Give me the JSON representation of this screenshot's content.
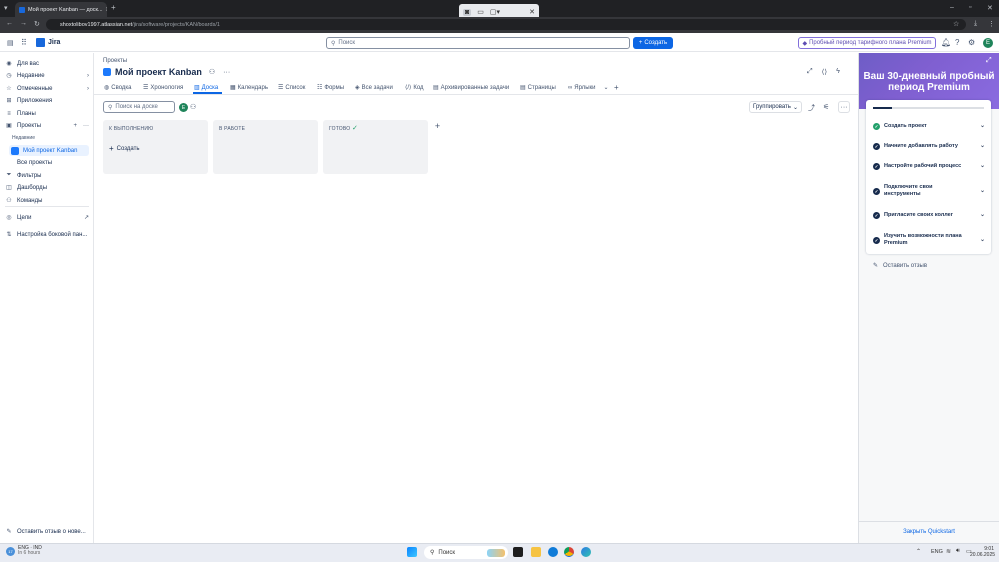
{
  "browser": {
    "tab_title": "Мой проект Kanban — доск...",
    "url_host": "shoxtolibov1997.atlassian.net",
    "url_path": "/jira/software/projects/KAN/boards/1"
  },
  "topnav": {
    "product": "Jira",
    "search_placeholder": "Поиск",
    "create_label": "Создать",
    "trial_label": "Пробный период тарифного плана Premium",
    "avatar_letter": "Е"
  },
  "sidebar": {
    "items": [
      {
        "label": "Для вас",
        "icon": "user-icon"
      },
      {
        "label": "Недавние",
        "icon": "clock-icon"
      },
      {
        "label": "Отмеченные",
        "icon": "star-icon"
      },
      {
        "label": "Приложения",
        "icon": "apps-icon"
      },
      {
        "label": "Планы",
        "icon": "plans-icon"
      },
      {
        "label": "Проекты",
        "icon": "projects-icon"
      }
    ],
    "recent_heading": "Недавние",
    "active_project": "Мой проект Kanban",
    "all_projects": "Все проекты",
    "more_items": [
      {
        "label": "Фильтры",
        "icon": "filter-icon"
      },
      {
        "label": "Дашборды",
        "icon": "dashboard-icon"
      },
      {
        "label": "Команды",
        "icon": "teams-icon"
      }
    ],
    "goals": "Цели",
    "customize": "Настройка боковой пан...",
    "feedback": "Оставить отзыв о нове..."
  },
  "project": {
    "breadcrumb": "Проекты",
    "title": "Мой проект Kanban",
    "tabs": [
      {
        "label": "Сводка",
        "icon": "globe-icon"
      },
      {
        "label": "Хронология",
        "icon": "timeline-icon"
      },
      {
        "label": "Доска",
        "icon": "board-icon"
      },
      {
        "label": "Календарь",
        "icon": "calendar-icon"
      },
      {
        "label": "Список",
        "icon": "list-icon"
      },
      {
        "label": "Формы",
        "icon": "form-icon"
      },
      {
        "label": "Все задачи",
        "icon": "issues-icon"
      },
      {
        "label": "Код",
        "icon": "code-icon"
      },
      {
        "label": "Архивированные задачи",
        "icon": "archive-icon"
      },
      {
        "label": "Страницы",
        "icon": "pages-icon"
      },
      {
        "label": "Ярлыки",
        "icon": "link-icon"
      }
    ],
    "board_search_placeholder": "Поиск на доске",
    "group_by": "Группировать",
    "avatar_letter": "Е"
  },
  "board": {
    "columns": [
      {
        "title": "К ВЫПОЛНЕНИЮ"
      },
      {
        "title": "В РАБОТЕ"
      },
      {
        "title": "ГОТОВО"
      }
    ],
    "create_label": "Создать"
  },
  "premium_panel": {
    "title": "Ваш 30-дневный пробный период Premium",
    "progress": 0.17,
    "tasks": [
      {
        "label": "Создать проект",
        "done": true
      },
      {
        "label": "Начните добавлять работу",
        "done": false
      },
      {
        "label": "Настройте рабочий процесс",
        "done": false
      },
      {
        "label": "Подключите свои инструменты",
        "done": false
      },
      {
        "label": "Пригласите своих коллег",
        "done": false
      },
      {
        "label": "Изучить возможности плана Premium",
        "done": false
      }
    ],
    "feedback": "Оставить отзыв",
    "close": "Закрыть Quickstart"
  },
  "taskbar": {
    "weather_temp": "17",
    "weather_text": "ENG · IND",
    "weather_sub": "In 6 hours",
    "search_placeholder": "Поиск",
    "lang": "ENG",
    "time": "9:01",
    "date": "20.06.2025"
  }
}
